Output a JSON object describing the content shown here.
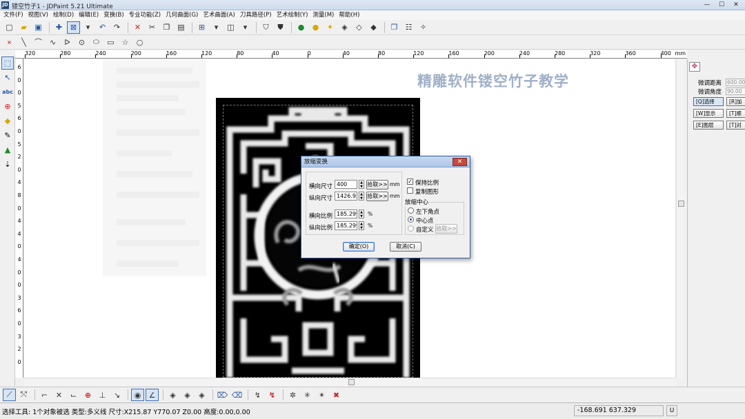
{
  "window": {
    "title": "镂空竹子1 - JDPaint 5.21 Ultimate",
    "app_icon": "JD",
    "min_glyph": "—",
    "max_glyph": "☐",
    "close_glyph": "✕"
  },
  "menu": [
    "文件(F)",
    "视图(V)",
    "绘制(D)",
    "编辑(E)",
    "变换(B)",
    "专业功能(Z)",
    "几何曲面(G)",
    "艺术曲面(A)",
    "刀具路径(P)",
    "艺术绘制(Y)",
    "测量(M)",
    "帮助(H)"
  ],
  "toolbar1": {
    "icons": [
      "new-file-icon",
      "open-folder-icon",
      "save-icon",
      "crosshair-icon",
      "select-window-icon",
      "dropdown-icon",
      "undo-icon",
      "redo-icon",
      "delete-icon",
      "cut-icon",
      "copy-icon",
      "paste-icon",
      "grid-icon",
      "layer-icon",
      "shield-icon",
      "shield-filled-icon",
      "light-green-icon",
      "bulb-icon",
      "lights-icon",
      "eraser-icon",
      "eraser2-icon",
      "group-icon",
      "table-icon",
      "wand-icon"
    ]
  },
  "toolbar2": {
    "icons": [
      "point-icon",
      "line-icon",
      "arc-icon",
      "spline-icon",
      "polyline-icon",
      "circle-dot-icon",
      "ellipse-icon",
      "rectangle-icon",
      "star-icon",
      "circle-icon"
    ]
  },
  "ruler": {
    "unit": "mm",
    "h_labels": [
      "320",
      "280",
      "240",
      "200",
      "160",
      "120",
      "80",
      "40",
      "0",
      "40",
      "80",
      "120",
      "160",
      "200",
      "240",
      "280",
      "320",
      "360",
      "400"
    ],
    "v_digits": [
      "6",
      "0",
      "0",
      "5",
      "6",
      "0",
      "5",
      "2",
      "0",
      "4",
      "8",
      "0",
      "4",
      "4",
      "0",
      "4",
      "0",
      "0",
      "3",
      "6",
      "0",
      "3",
      "2",
      "0"
    ]
  },
  "canvas": {
    "watermark": "精雕软件镂空竹子教学"
  },
  "dialog": {
    "title": "放缩变换",
    "close": "✕",
    "h_size_label": "横向尺寸",
    "h_size_value": "400",
    "v_size_label": "纵向尺寸",
    "v_size_value": "1426.93",
    "pick_label": "拾取>>",
    "mm": "mm",
    "h_ratio_label": "横向比例",
    "h_ratio_value": "185.299",
    "v_ratio_label": "纵向比例",
    "v_ratio_value": "185.299",
    "percent": "%",
    "keep_ratio_label": "保持比例",
    "keep_ratio_checked": true,
    "copy_label": "复制图形",
    "copy_checked": false,
    "center_group_label": "放缩中心",
    "center_options": [
      "左下角点",
      "中心点",
      "自定义"
    ],
    "center_selected": "中心点",
    "pick_disabled_label": "拾取>>",
    "ok_label": "确定(O)",
    "cancel_label": "取消(C)"
  },
  "right_panel": {
    "tab_icon": "pattern-icon",
    "fine_dist_label": "微调距离",
    "fine_dist_value": "600.00",
    "fine_angle_label": "微调角度",
    "fine_angle_value": "90.00",
    "buttons": [
      "[Q]选择",
      "[R]加",
      "[W]显示",
      "[T]顺",
      "[E]图层",
      "[T]对"
    ]
  },
  "bottom_toolbar": {
    "icons": [
      "line-tool-icon",
      "trim-icon",
      "corner-icon",
      "cross-icon",
      "corner2-icon",
      "target-icon",
      "perpendicular-icon",
      "tangent-icon",
      "snap-point-icon",
      "snap-angle-icon",
      "diamond-icon",
      "diamond2-icon",
      "diamond3-icon",
      "scraper-icon",
      "scraper2-icon",
      "arrows-icon",
      "arrows2-icon",
      "node-icon",
      "node2-icon",
      "node3-icon",
      "close-x-icon"
    ]
  },
  "status": {
    "text": "选择工具: 1个对象被选 类型:多义线 尺寸:X215.87 Y770.07 Z0.00 高度:0.00,0.00",
    "coords": "-168.691 637.329",
    "mode": "U"
  }
}
